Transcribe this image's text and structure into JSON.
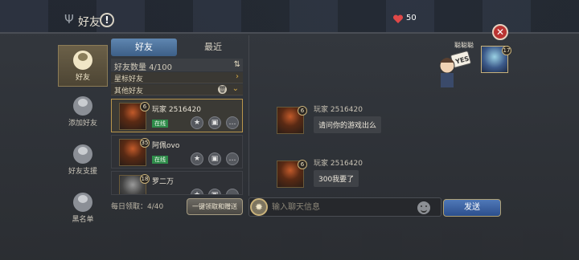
{
  "header": {
    "title": "好友",
    "help_label": "!",
    "heart_count": "50"
  },
  "nav": {
    "items": [
      {
        "label": "好友",
        "icon": "friends-icon",
        "active": true
      },
      {
        "label": "添加好友",
        "icon": "add-friend-icon",
        "active": false
      },
      {
        "label": "好友支援",
        "icon": "friend-support-icon",
        "active": false
      },
      {
        "label": "黑名单",
        "icon": "blacklist-icon",
        "active": false
      }
    ]
  },
  "tabs": [
    {
      "label": "好友",
      "active": true
    },
    {
      "label": "最近",
      "active": false
    }
  ],
  "friend_count": "好友数量 4/100",
  "groups": [
    {
      "label": "星标好友"
    },
    {
      "label": "其他好友"
    }
  ],
  "friends": [
    {
      "name": "玩家 2516420",
      "level": "6",
      "status": "在线"
    },
    {
      "name": "阿佩ovo",
      "level": "35",
      "status": "在线"
    },
    {
      "name": "罗二万",
      "level": "18",
      "status": ""
    }
  ],
  "daily_claim": "每日领取：4/40",
  "claim_button": "一键领取和赠送",
  "partner": {
    "name": "聪聪聪",
    "level": "17",
    "sign_text": "YES"
  },
  "messages": [
    {
      "sender": "玩家 2516420",
      "level": "6",
      "text": "请问你的游戏出么"
    },
    {
      "sender": "玩家 2516420",
      "level": "6",
      "text": "300我要了"
    }
  ],
  "input": {
    "placeholder": "输入聊天信息"
  },
  "send_button": "发送",
  "colors": {
    "accent_blue": "#3d5f87",
    "online_green": "#2f8c4a",
    "close_red": "#b93432",
    "gold_border": "#b9954c"
  }
}
